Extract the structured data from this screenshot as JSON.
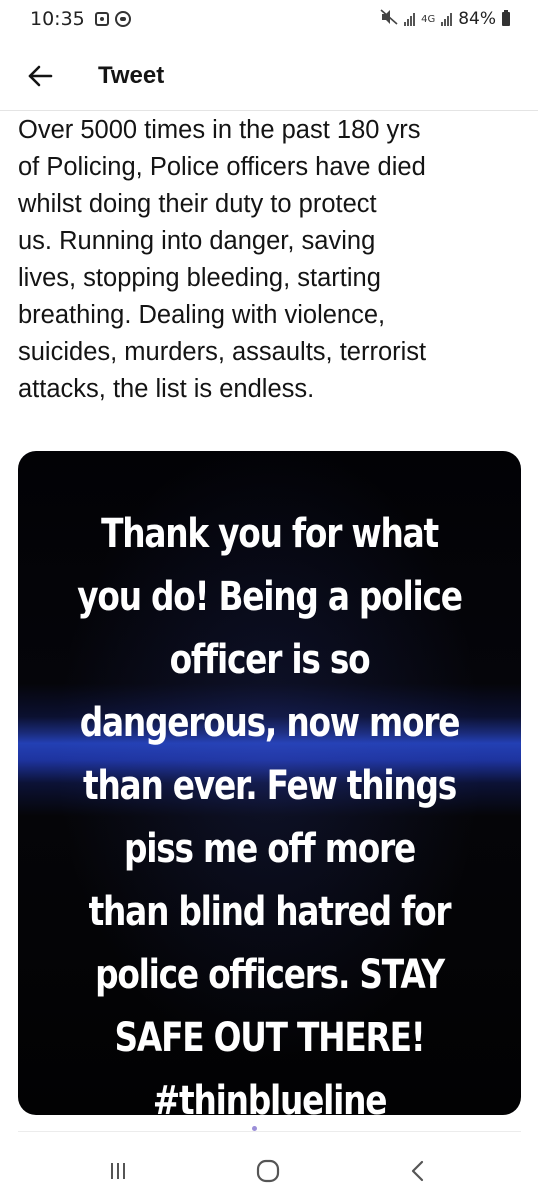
{
  "status_bar": {
    "time": "10:35",
    "network_label": "4G",
    "battery_percent": "84%",
    "icons": [
      "notification-icon",
      "game-icon",
      "mute-icon",
      "signal-icon",
      "battery-icon"
    ]
  },
  "header": {
    "title": "Tweet",
    "back_icon": "arrow-left-icon"
  },
  "tweet": {
    "text": "Over 5000 times in the past 180 yrs\nof Policing, Police officers have died\nwhilst doing their duty to protect\nus. Running into danger, saving\nlives, stopping bleeding, starting\nbreathing. Dealing with violence,\nsuicides, murders, assaults, terrorist\nattacks, the list is endless.",
    "media": {
      "caption": "Thank you for what\nyou do! Being a police\nofficer is so\ndangerous, now more\nthan ever. Few things\npiss me off more\nthan blind hatred for\npolice officers. STAY\nSAFE OUT THERE!\n#thinblueline",
      "colors": {
        "background": "#030305",
        "blue_line": "#2340b4",
        "text": "#ffffff"
      }
    }
  },
  "nav_bar": {
    "buttons": [
      "recent-apps-icon",
      "home-icon",
      "back-icon"
    ]
  }
}
